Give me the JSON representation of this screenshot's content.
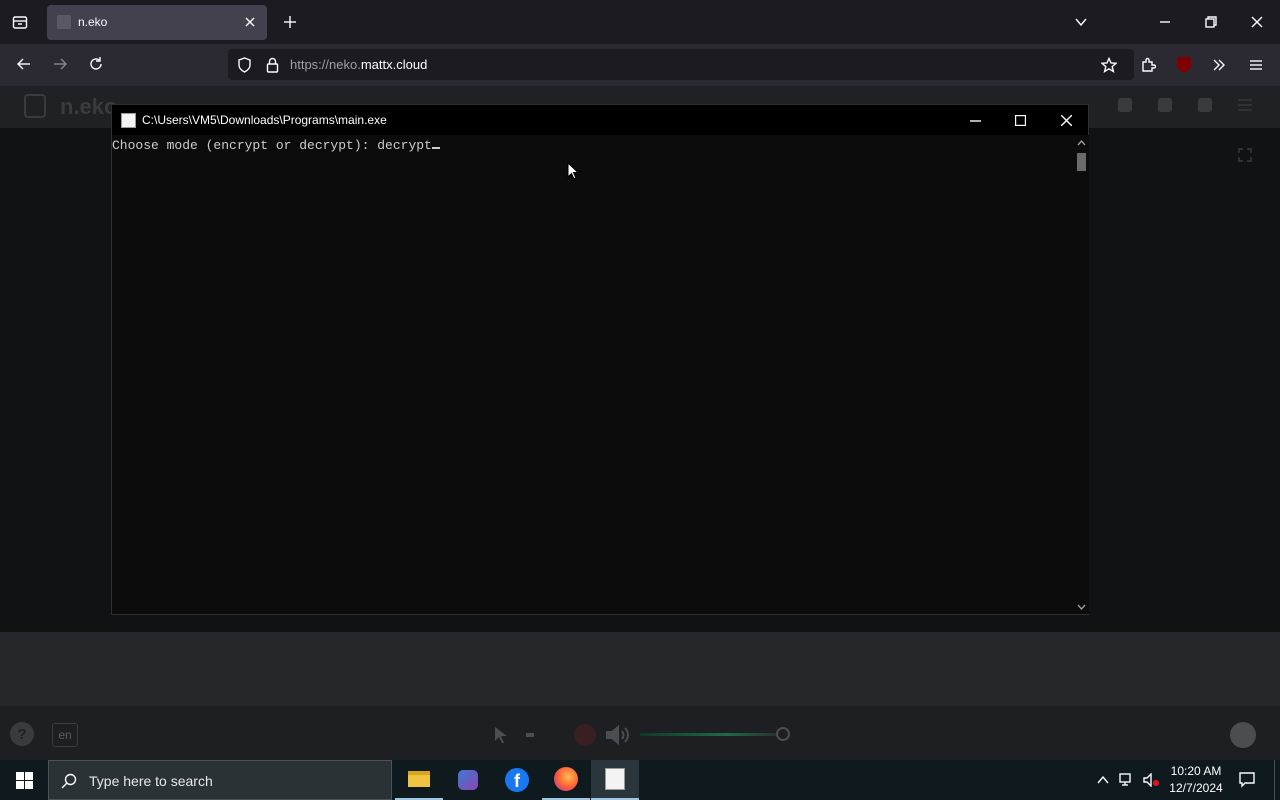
{
  "browser": {
    "tab_title": "n.eko",
    "url_prefix": "https://neko.",
    "url_domain": "mattx.cloud"
  },
  "neko": {
    "logo_text": "n.eko",
    "language": "en"
  },
  "console": {
    "title": "C:\\Users\\VM5\\Downloads\\Programs\\main.exe",
    "line": "Choose mode (encrypt or decrypt): decrypt"
  },
  "taskbar": {
    "search_placeholder": "Type here to search",
    "time": "10:20 AM",
    "date": "12/7/2024"
  },
  "colors": {
    "console_bg": "#0c0c0c",
    "console_text": "#cccccc",
    "taskbar_bg": "#0f1a1f",
    "browser_tabbar": "#1c1b22",
    "facebook_blue": "#1877f2",
    "ublock_red": "#800000"
  }
}
